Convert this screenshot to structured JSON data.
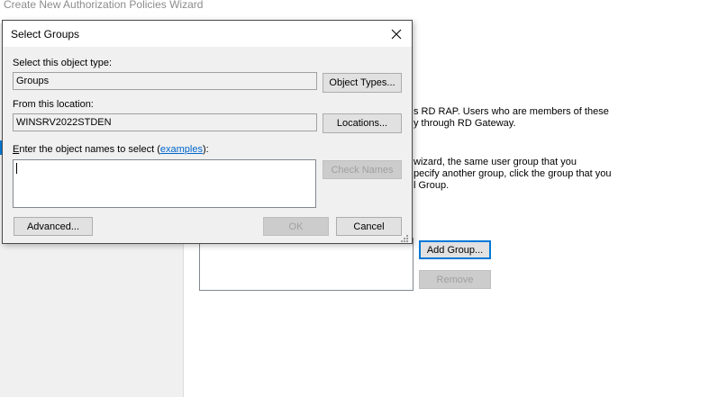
{
  "wizard": {
    "title": "Create New Authorization Policies Wizard",
    "text_lines_1": [
      "s RD RAP. Users who are members of these",
      "y through RD Gateway."
    ],
    "text_lines_2": [
      "wizard, the same user group that you",
      "pecify another group, click the group that you",
      "l Group."
    ],
    "add_group_label": "Add Group...",
    "remove_label": "Remove"
  },
  "dialog": {
    "title": "Select Groups",
    "object_type_label": "Select this object type:",
    "object_type_value": "Groups",
    "object_types_button": "Object Types...",
    "location_label": "From this location:",
    "location_value": "WINSRV2022STDEN",
    "locations_button": "Locations...",
    "names_label_prefix": "nter the object names to select (",
    "names_label_accel": "E",
    "names_label_link": "examples",
    "names_label_suffix": "):",
    "names_value": "",
    "check_names_button": "Check Names",
    "advanced_button": "Advanced...",
    "ok_button": "OK",
    "cancel_button": "Cancel"
  },
  "icons": {
    "close": "close-icon",
    "resize_grip": "resize-grip-icon"
  },
  "colors": {
    "accent": "#0078d7",
    "link": "#0066cc",
    "dialog_bg": "#f0f0f0"
  }
}
